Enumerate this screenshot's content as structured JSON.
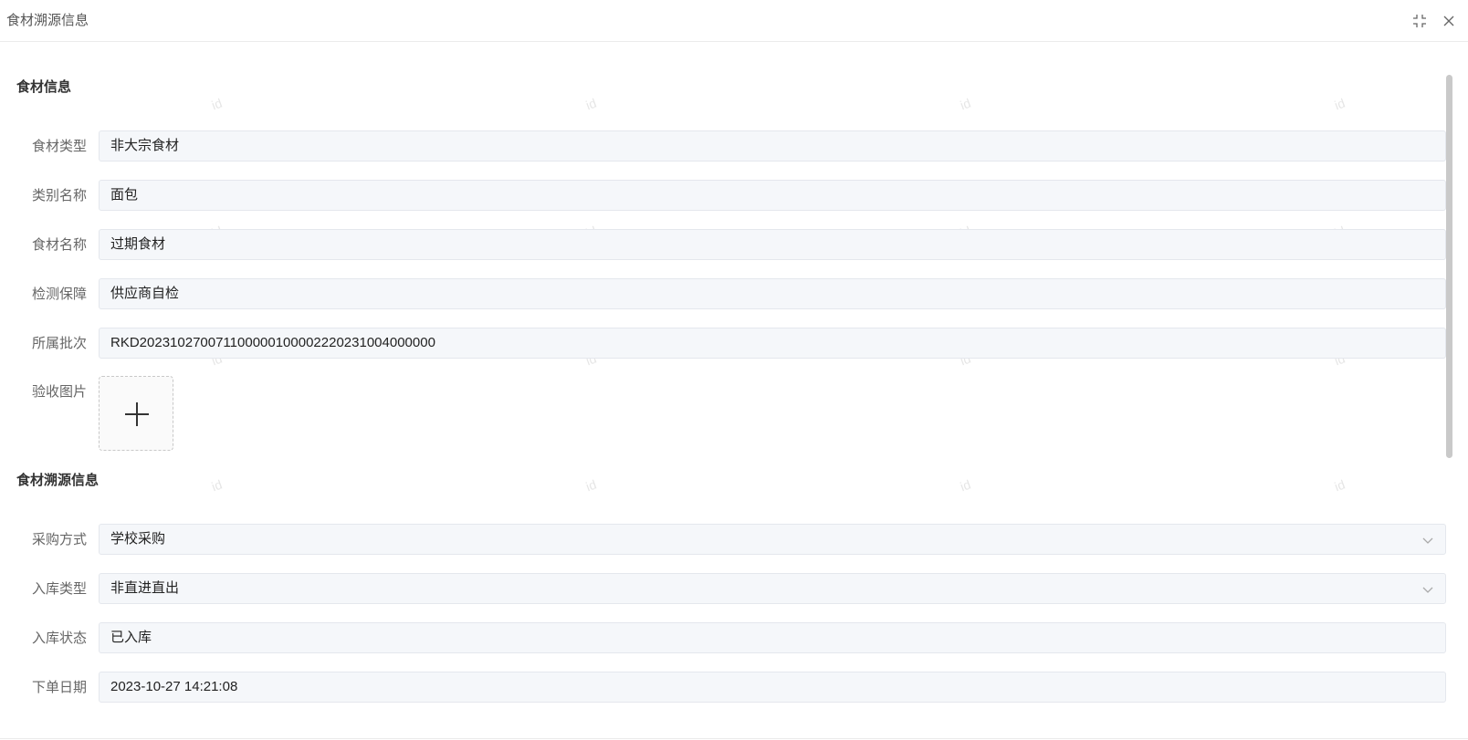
{
  "dialog": {
    "title": "食材溯源信息",
    "icons": {
      "collapse": "collapse-icon",
      "close": "close-icon"
    }
  },
  "section1": {
    "title": "食材信息",
    "fields": [
      {
        "label": "食材类型",
        "value": "非大宗食材"
      },
      {
        "label": "类别名称",
        "value": "面包"
      },
      {
        "label": "食材名称",
        "value": "过期食材"
      },
      {
        "label": "检测保障",
        "value": "供应商自检"
      },
      {
        "label": "所属批次",
        "value": "RKD202310270071100000100002220231004000000"
      }
    ],
    "upload": {
      "label": "验收图片",
      "icon": "plus-icon"
    }
  },
  "section2": {
    "title": "食材溯源信息",
    "fields": [
      {
        "label": "采购方式",
        "value": "学校采购",
        "type": "select"
      },
      {
        "label": "入库类型",
        "value": "非直进直出",
        "type": "select"
      },
      {
        "label": "入库状态",
        "value": "已入库"
      },
      {
        "label": "下单日期",
        "value": "2023-10-27 14:21:08"
      }
    ]
  },
  "watermark": {
    "text": "id",
    "color": "#e6e6e6"
  }
}
